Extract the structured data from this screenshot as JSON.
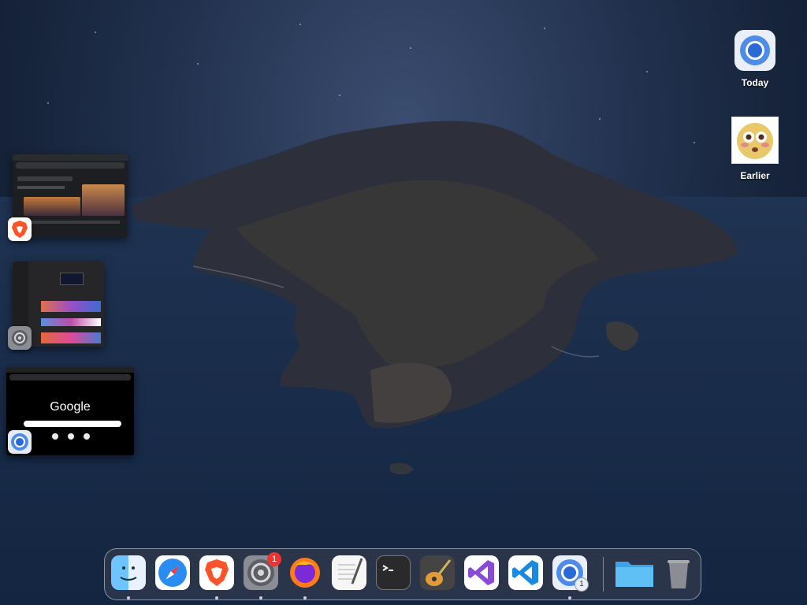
{
  "desktop": {
    "items": [
      {
        "label": "Today",
        "icon": "chromium-icon"
      },
      {
        "label": "Earlier",
        "icon": "emoji-face-image"
      }
    ]
  },
  "stage_manager": {
    "windows": [
      {
        "app": "Brave Browser",
        "icon": "brave-icon"
      },
      {
        "app": "System Settings",
        "icon": "gear-icon"
      },
      {
        "app": "Chromium",
        "icon": "chromium-icon",
        "content_text": "Google"
      }
    ]
  },
  "dock": {
    "apps": [
      {
        "name": "Finder",
        "icon": "finder-icon",
        "running": true
      },
      {
        "name": "Safari",
        "icon": "safari-icon",
        "running": false
      },
      {
        "name": "Brave Browser",
        "icon": "brave-icon",
        "running": true
      },
      {
        "name": "System Settings",
        "icon": "gear-icon",
        "running": true,
        "badge": "1"
      },
      {
        "name": "Firefox",
        "icon": "firefox-icon",
        "running": true
      },
      {
        "name": "TextEdit",
        "icon": "textedit-icon",
        "running": false
      },
      {
        "name": "Terminal",
        "icon": "terminal-icon",
        "running": false
      },
      {
        "name": "GarageBand",
        "icon": "guitar-icon",
        "running": false
      },
      {
        "name": "Visual Studio",
        "icon": "visual-studio-icon",
        "running": false
      },
      {
        "name": "VS Code",
        "icon": "vscode-icon",
        "running": false
      },
      {
        "name": "Chromium",
        "icon": "chromium-icon",
        "running": true,
        "badge": "1"
      },
      {
        "name": "Downloads",
        "icon": "folder-icon",
        "running": false
      },
      {
        "name": "Trash",
        "icon": "trash-icon",
        "running": false
      }
    ]
  }
}
